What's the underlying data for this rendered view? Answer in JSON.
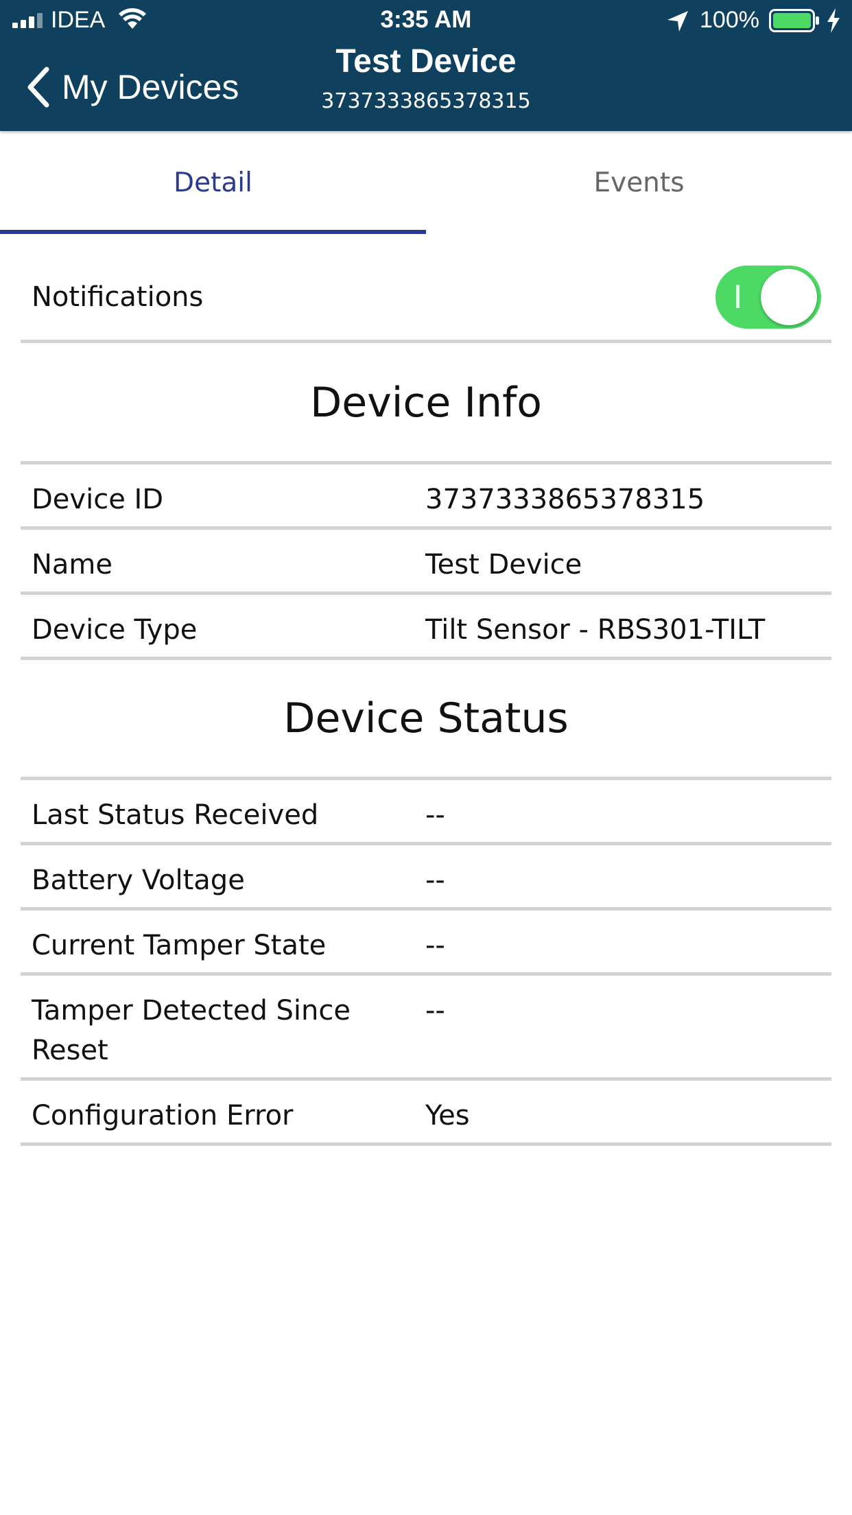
{
  "status_bar": {
    "carrier": "IDEA",
    "time": "3:35 AM",
    "battery_percent": "100%",
    "battery_color": "#4cd964"
  },
  "nav": {
    "back_label": "My Devices",
    "title": "Test Device",
    "subtitle": "3737333865378315",
    "background_color": "#0f405e"
  },
  "tabs": [
    {
      "label": "Detail",
      "active": true
    },
    {
      "label": "Events",
      "active": false
    }
  ],
  "accent_color": "#2b3990",
  "notifications": {
    "label": "Notifications",
    "enabled": true,
    "toggle_color": "#4cd964"
  },
  "device_info": {
    "title": "Device Info",
    "rows": [
      {
        "label": "Device ID",
        "value": "3737333865378315"
      },
      {
        "label": "Name",
        "value": "Test Device"
      },
      {
        "label": "Device Type",
        "value": "Tilt Sensor - RBS301-TILT"
      }
    ]
  },
  "device_status": {
    "title": "Device Status",
    "rows": [
      {
        "label": "Last Status Received",
        "value": "--"
      },
      {
        "label": "Battery Voltage",
        "value": "--"
      },
      {
        "label": "Current Tamper State",
        "value": "--"
      },
      {
        "label": "Tamper Detected Since Reset",
        "value": "--"
      },
      {
        "label": "Configuration Error",
        "value": "Yes"
      }
    ]
  }
}
